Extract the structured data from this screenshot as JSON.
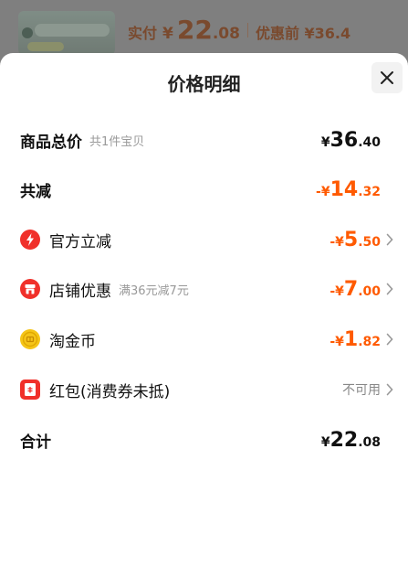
{
  "background": {
    "price_label": "实付",
    "yen": "¥",
    "price_int": "22",
    "price_dec": ".08",
    "before_label": "优惠前 ¥36.4"
  },
  "sheet": {
    "title": "价格明细",
    "rows": [
      {
        "label": "商品总价",
        "sub": "共1件宝贝",
        "sign": "",
        "yen": "¥",
        "int": "36",
        "dec": ".40"
      },
      {
        "label": "共减",
        "sign": "-",
        "yen": "¥",
        "int": "14",
        "dec": ".32"
      },
      {
        "label": "官方立减",
        "icon": "lightning-icon",
        "sign": "-",
        "yen": "¥",
        "int": "5",
        "dec": ".50"
      },
      {
        "label": "店铺优惠",
        "icon": "shop-icon",
        "sub": "满36元减7元",
        "sign": "-",
        "yen": "¥",
        "int": "7",
        "dec": ".00"
      },
      {
        "label": "淘金币",
        "icon": "coin-icon",
        "sign": "-",
        "yen": "¥",
        "int": "1",
        "dec": ".82"
      },
      {
        "label": "红包(消费券未抵)",
        "icon": "red-packet-icon",
        "status": "不可用"
      },
      {
        "label": "合计",
        "sign": "",
        "yen": "¥",
        "int": "22",
        "dec": ".08"
      }
    ]
  },
  "colors": {
    "accent": "#ff5a00",
    "icon_red": "#f0302a",
    "icon_gold": "#f5c518"
  }
}
